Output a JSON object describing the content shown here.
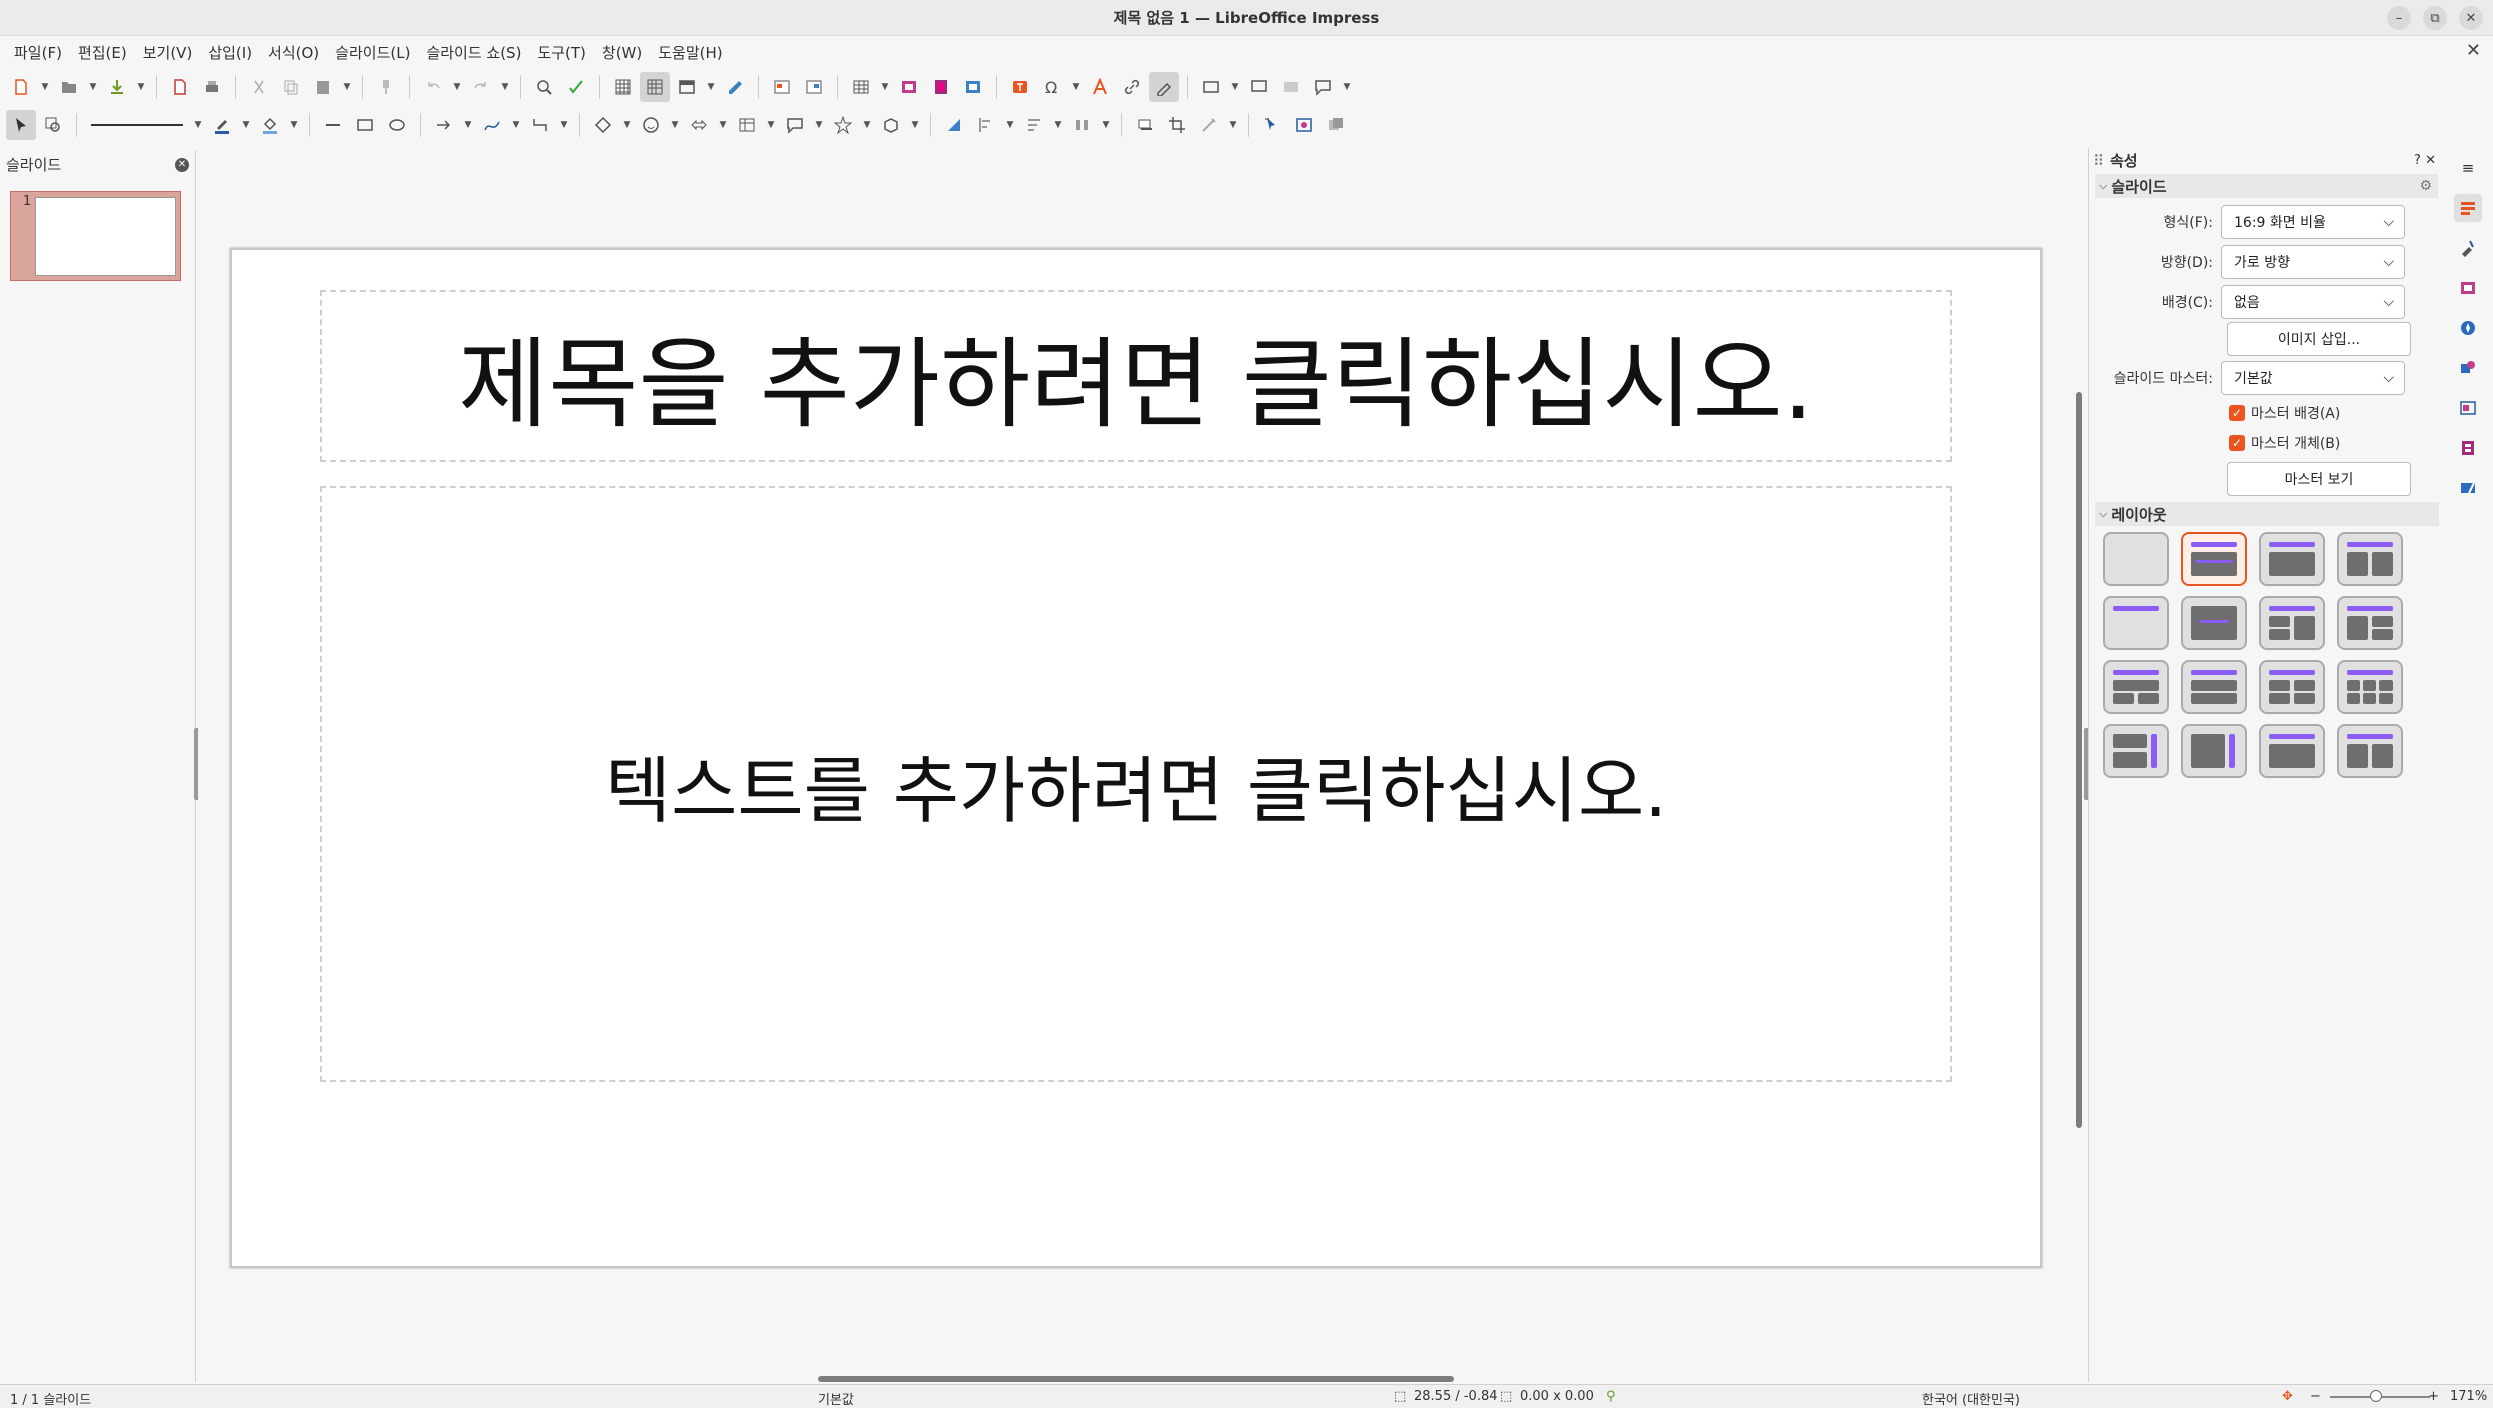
{
  "window": {
    "title": "제목 없음 1 — LibreOffice Impress",
    "controls": [
      "–",
      "⧉",
      "✕"
    ],
    "doc_close": "✕"
  },
  "menu": [
    "파일(F)",
    "편집(E)",
    "보기(V)",
    "삽입(I)",
    "서식(O)",
    "슬라이드(L)",
    "슬라이드 쇼(S)",
    "도구(T)",
    "창(W)",
    "도움말(H)"
  ],
  "slide_pane": {
    "title": "슬라이드",
    "slides": [
      {
        "number": "1"
      }
    ]
  },
  "slide": {
    "title_placeholder": "제목을 추가하려면 클릭하십시오.",
    "content_placeholder": "텍스트를 추가하려면 클릭하십시오."
  },
  "sidebar": {
    "title": "속성",
    "help": "?",
    "close": "✕",
    "menu_icon": "≡",
    "slide_section": {
      "title": "슬라이드",
      "format_label": "형식(F):",
      "format_value": "16:9 화면 비율",
      "orientation_label": "방향(D):",
      "orientation_value": "가로 방향",
      "background_label": "배경(C):",
      "background_value": "없음",
      "insert_image": "이미지 삽입...",
      "master_label": "슬라이드 마스터:",
      "master_value": "기본값",
      "master_background": "마스터 배경(A)",
      "master_background_checked": true,
      "master_objects": "마스터 개체(B)",
      "master_objects_checked": true,
      "show_master": "마스터 보기"
    },
    "layout_section": {
      "title": "레이아웃",
      "selected_index": 1,
      "count": 16
    }
  },
  "status": {
    "slide_info": "1 / 1 슬라이드",
    "master": "기본값",
    "position": "28.55 / -0.84",
    "size": "0.00 x 0.00",
    "language": "한국어 (대한민국)",
    "zoom_minus": "−",
    "zoom_plus": "+",
    "zoom": "171%"
  },
  "colors": {
    "accent": "#e95420",
    "layout_bar": "#8b5cf6",
    "selected_thumb": "#d9a59a"
  }
}
